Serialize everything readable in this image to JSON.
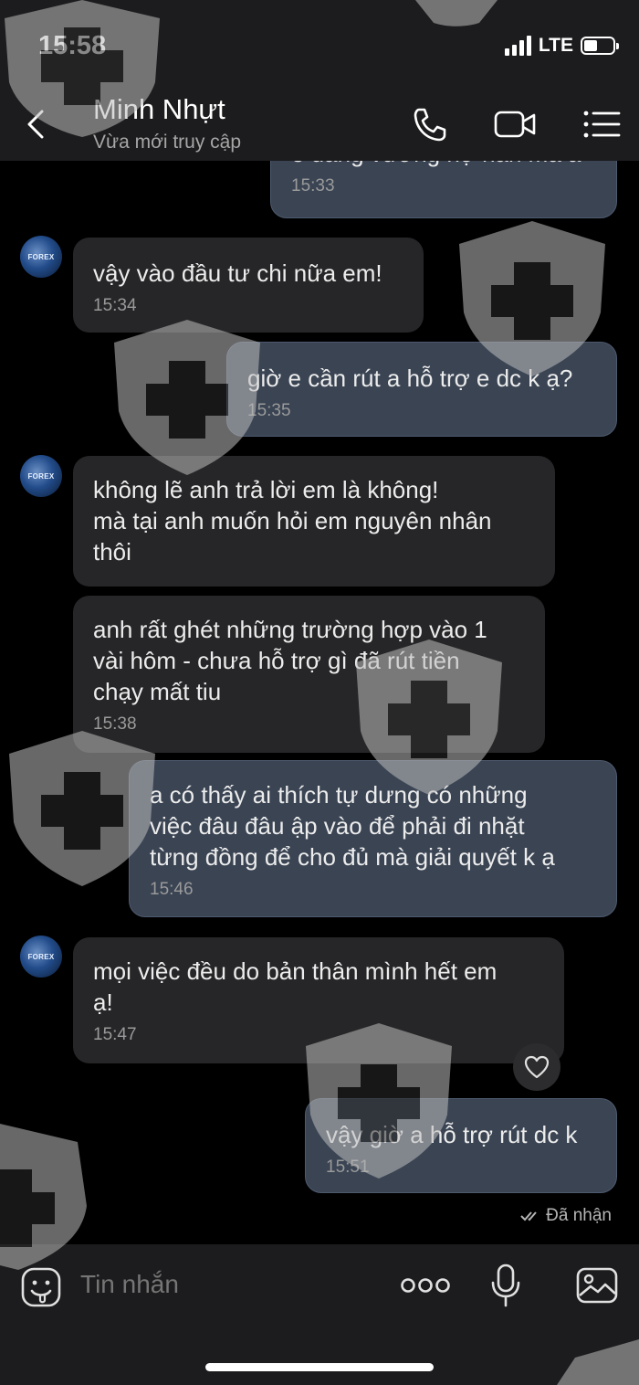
{
  "status_bar": {
    "time": "15:58",
    "network": "LTE"
  },
  "header": {
    "contact_name": "Minh Nhựt",
    "contact_status": "Vừa mới truy cập"
  },
  "avatar_label": "FOREX",
  "messages": [
    {
      "direction": "out",
      "text": "e đang vướng nợ nần mà a",
      "time": "15:33"
    },
    {
      "direction": "in",
      "text": "vậy vào đầu tư chi nữa em!",
      "time": "15:34"
    },
    {
      "direction": "out",
      "text": "giờ e cần rút a hỗ trợ e dc k ạ?",
      "time": "15:35"
    },
    {
      "direction": "in",
      "text": "không lẽ anh trả lời em là không!\nmà tại anh muốn hỏi em nguyên nhân\nthôi",
      "time": ""
    },
    {
      "direction": "in",
      "text": "anh rất ghét những trường hợp vào 1\nvài hôm - chưa hỗ trợ gì đã rút tiền\nchạy mất tiu",
      "time": "15:38"
    },
    {
      "direction": "out",
      "text": "a có thấy ai thích tự dưng có những\nviệc đâu đâu ập vào để phải đi nhặt\ntừng đồng để cho đủ mà giải quyết k ạ",
      "time": "15:46"
    },
    {
      "direction": "in",
      "text": "mọi việc đều do bản thân mình hết em\nạ!",
      "time": "15:47"
    },
    {
      "direction": "out",
      "text": "vậy giờ a hỗ trợ rút dc k",
      "time": "15:51"
    }
  ],
  "read_receipt": "Đã nhận",
  "input": {
    "placeholder": "Tin nhắn"
  },
  "colors": {
    "background": "#000000",
    "bar": "#1c1c1e",
    "incoming_bubble": "#262628",
    "outgoing_bubble": "#3a4453"
  },
  "icons": [
    "back-icon",
    "phone-icon",
    "video-call-icon",
    "menu-icon",
    "heart-icon",
    "double-check-icon",
    "sticker-icon",
    "more-icon",
    "mic-icon",
    "gallery-icon",
    "watermark-shield-icon"
  ]
}
